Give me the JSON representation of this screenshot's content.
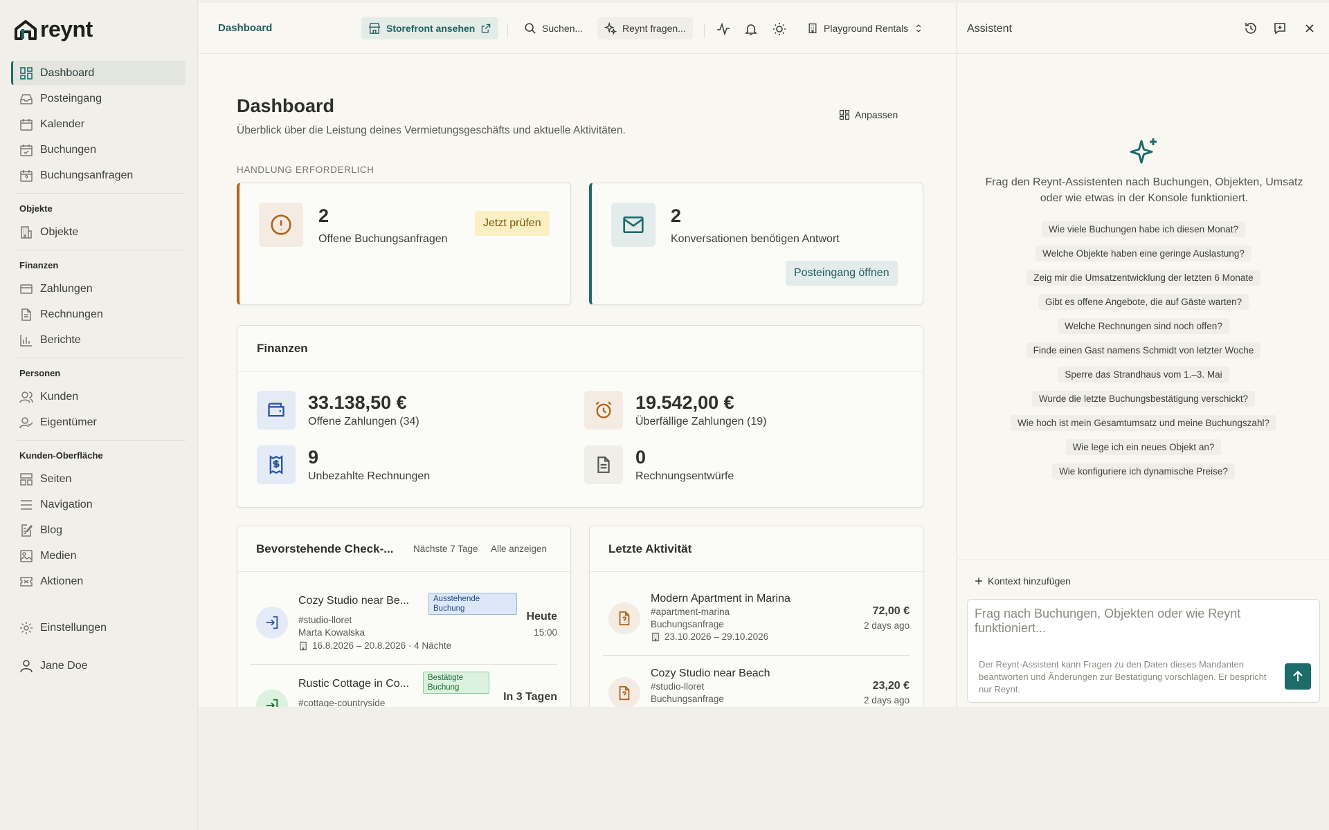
{
  "sidebar": {
    "logo": "reynt",
    "items": {
      "dashboard": "Dashboard",
      "inbox": "Posteingang",
      "calendar": "Kalender",
      "bookings": "Buchungen",
      "requests": "Buchungsanfragen",
      "objects_section": "Objekte",
      "objects": "Objekte",
      "finance_section": "Finanzen",
      "payments": "Zahlungen",
      "invoices": "Rechnungen",
      "reports": "Berichte",
      "people_section": "Personen",
      "customers": "Kunden",
      "owners": "Eigentümer",
      "surface_section": "Kunden-Oberfläche",
      "pages": "Seiten",
      "navigation": "Navigation",
      "blog": "Blog",
      "media": "Medien",
      "promotions": "Aktionen",
      "settings": "Einstellungen",
      "user": "Jane Doe"
    }
  },
  "topbar": {
    "breadcrumb": "Dashboard",
    "storefront": "Storefront ansehen",
    "search": "Suchen...",
    "ask": "Reynt fragen...",
    "tenant": "Playground Rentals"
  },
  "page": {
    "title": "Dashboard",
    "subtitle": "Überblick über die Leistung deines Vermietungsgeschäfts und aktuelle Aktivitäten.",
    "customize": "Anpassen",
    "section_label": "HANDLUNG ERFORDERLICH"
  },
  "alerts": [
    {
      "count": "2",
      "label": "Offene Buchungsanfragen",
      "action": "Jetzt prüfen"
    },
    {
      "count": "2",
      "label": "Konversationen benötigen Antwort",
      "action": "Posteingang öffnen"
    }
  ],
  "finance": {
    "title": "Finanzen",
    "open_payments": {
      "value": "33.138,50 €",
      "label": "Offene Zahlungen (34)"
    },
    "overdue_payments": {
      "value": "19.542,00 €",
      "label": "Überfällige Zahlungen (19)"
    },
    "unpaid_invoices": {
      "value": "9",
      "label": "Unbezahlte Rechnungen"
    },
    "draft_invoices": {
      "value": "0",
      "label": "Rechnungsentwürfe"
    }
  },
  "checkins": {
    "title": "Bevorstehende Check-...",
    "range": "Nächste 7 Tage",
    "show_all": "Alle anzeigen",
    "rows": [
      {
        "title": "Cozy Studio near Be...",
        "slug": "#studio-lloret",
        "guest": "Marta Kowalska",
        "dates": "16.8.2026 – 20.8.2026 · 4 Nächte",
        "badge": "Ausstehende Buchung",
        "when": "Heute",
        "time": "15:00"
      },
      {
        "title": "Rustic Cottage in Co...",
        "slug": "#cottage-countryside",
        "badge": "Bestätigte Buchung",
        "when": "In 3 Tagen"
      }
    ]
  },
  "activity": {
    "title": "Letzte Aktivität",
    "rows": [
      {
        "title": "Modern Apartment in Marina",
        "slug": "#apartment-marina",
        "type": "Buchungsanfrage",
        "dates": "23.10.2026 – 29.10.2026",
        "amount": "72,00 €",
        "ago": "2 days ago"
      },
      {
        "title": "Cozy Studio near Beach",
        "slug": "#studio-lloret",
        "type": "Buchungsanfrage",
        "amount": "23,20 €",
        "ago": "2 days ago"
      }
    ]
  },
  "assistant": {
    "title": "Assistent",
    "intro": "Frag den Reynt-Assistenten nach Buchungen, Objekten, Umsatz oder wie etwas in der Konsole funktioniert.",
    "suggestions": [
      "Wie viele Buchungen habe ich diesen Monat?",
      "Welche Objekte haben eine geringe Auslastung?",
      "Zeig mir die Umsatzentwicklung der letzten 6 Monate",
      "Gibt es offene Angebote, die auf Gäste warten?",
      "Welche Rechnungen sind noch offen?",
      "Finde einen Gast namens Schmidt von letzter Woche",
      "Sperre das Strandhaus vom 1.–3. Mai",
      "Wurde die letzte Buchungsbestätigung verschickt?",
      "Wie hoch ist mein Gesamtumsatz und meine Buchungszahl?",
      "Wie lege ich ein neues Objekt an?",
      "Wie konfiguriere ich dynamische Preise?"
    ],
    "add_context": "Kontext hinzufügen",
    "placeholder": "Frag nach Buchungen, Objekten oder wie Reynt funktioniert...",
    "disclaimer": "Der Reynt-Assistent kann Fragen zu den Daten dieses Mandanten beantworten und Änderungen zur Bestätigung vorschlagen. Er bespricht nur Reynt."
  },
  "colors": {
    "accent": "#1e6b6b",
    "warning": "#b0651c",
    "background": "#f8f7f2"
  }
}
